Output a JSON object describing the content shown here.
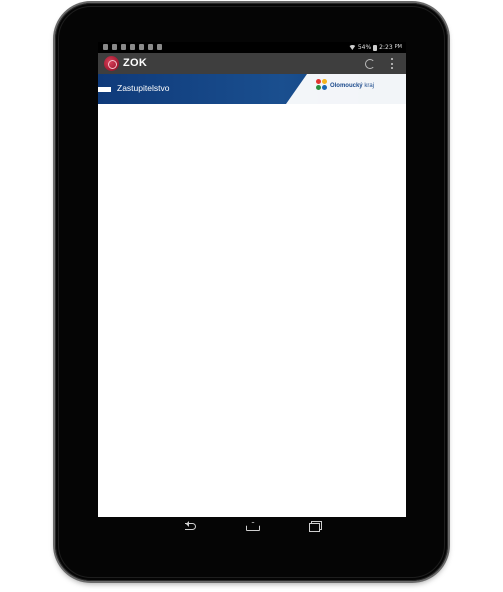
{
  "status_bar": {
    "battery_text": "54%",
    "time": "2:23",
    "ampm": "PM"
  },
  "action_bar": {
    "app_title": "ZOK",
    "actions": [
      {
        "icon": "refresh-icon"
      },
      {
        "icon": "overflow-menu-icon"
      }
    ]
  },
  "header": {
    "title": "Zastupitelstvo",
    "logo_text_bold": "Olomoucký",
    "logo_text_regular": "kraj"
  },
  "colors": {
    "action_bar_bg": "#3e3e3e",
    "header_bg": "#1a4f8f",
    "app_icon": "#a0172e",
    "screen_bg": "#ffffff"
  },
  "nav_bar": {
    "buttons": [
      "back-icon",
      "home-icon",
      "recents-icon"
    ]
  }
}
